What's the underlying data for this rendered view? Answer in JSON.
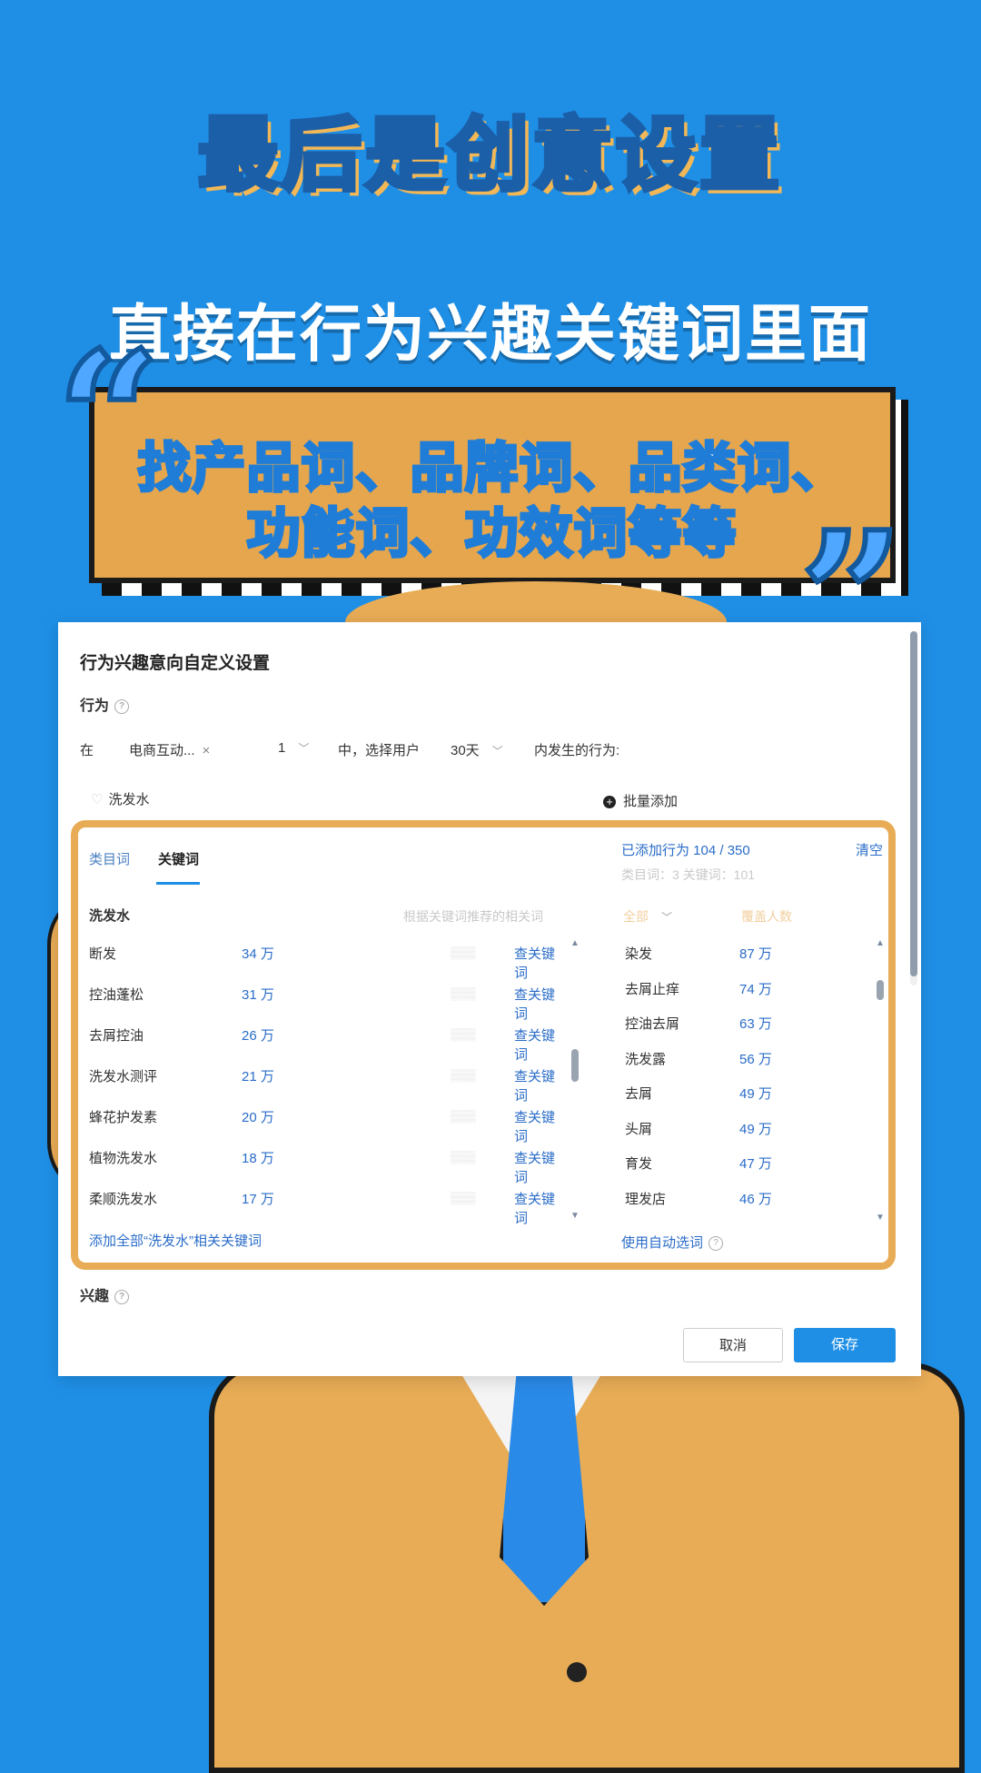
{
  "headline": "最后是创意设置",
  "subtitle": "直接在行为兴趣关键词里面",
  "banner": {
    "line1": "找产品词、品牌词、品类词、",
    "line2": "功能词、功效词等等",
    "open_quote": "“",
    "close_quote": "”"
  },
  "dialog": {
    "title": "行为兴趣意向自定义设置",
    "behavior_label": "行为",
    "row": {
      "prefix": "在",
      "scene_tag": "电商互动...",
      "tag_remove": "×",
      "count_select": "1",
      "middle": "中，选择用户",
      "days_select": "30天",
      "suffix": "内发生的行为:"
    },
    "search_keyword": "洗发水",
    "bulk_add": "批量添加",
    "panel": {
      "tabs": [
        "类目词",
        "关键词"
      ],
      "added_label": "已添加行为 104 / 350",
      "clear": "清空",
      "added_detail": "类目词：3    关键词：101",
      "group_title": "洗发水",
      "left_header": "根据关键词推荐的相关词",
      "right_header_sort": "全部",
      "right_header_people": "覆盖人数",
      "left_rows": [
        {
          "word": "断发",
          "count": "34 万",
          "action": "查关键词"
        },
        {
          "word": "控油蓬松",
          "count": "31 万",
          "action": "查关键词"
        },
        {
          "word": "去屑控油",
          "count": "26 万",
          "action": "查关键词"
        },
        {
          "word": "洗发水测评",
          "count": "21 万",
          "action": "查关键词"
        },
        {
          "word": "蜂花护发素",
          "count": "20 万",
          "action": "查关键词"
        },
        {
          "word": "植物洗发水",
          "count": "18 万",
          "action": "查关键词"
        },
        {
          "word": "柔顺洗发水",
          "count": "17 万",
          "action": "查关键词"
        }
      ],
      "right_rows": [
        {
          "word": "染发",
          "count": "87 万"
        },
        {
          "word": "去屑止痒",
          "count": "74 万"
        },
        {
          "word": "控油去屑",
          "count": "63 万"
        },
        {
          "word": "洗发露",
          "count": "56 万"
        },
        {
          "word": "去屑",
          "count": "49 万"
        },
        {
          "word": "头屑",
          "count": "49 万"
        },
        {
          "word": "育发",
          "count": "47 万"
        },
        {
          "word": "理发店",
          "count": "46 万"
        }
      ],
      "add_all": "添加全部“洗发水”相关关键词",
      "auto_select": "使用自动选词"
    },
    "interest_label": "兴趣",
    "cancel": "取消",
    "save": "保存"
  },
  "colors": {
    "background": "#1f8fe6",
    "banner": "#e6a64d",
    "accent": "#1f8fe6",
    "panel_border": "#e8ac56"
  }
}
